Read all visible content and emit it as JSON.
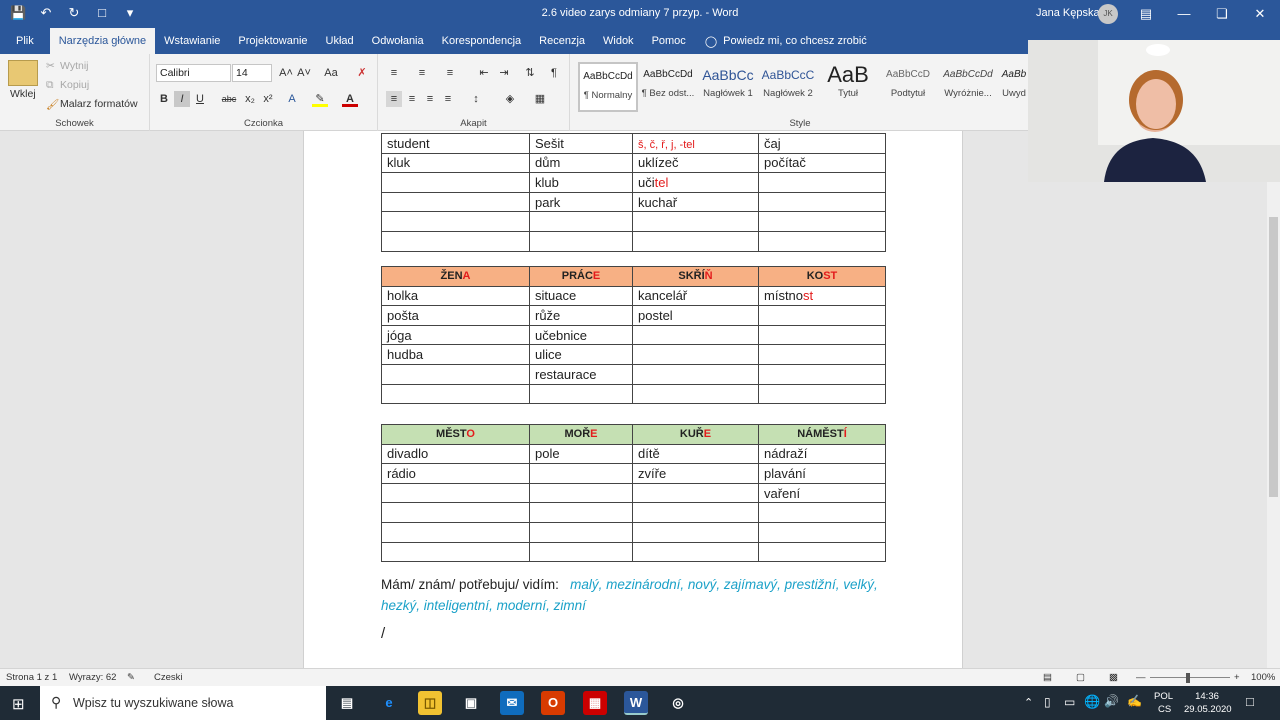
{
  "window": {
    "title": "2.6 video zarys odmiany 7 przyp.  -  Word",
    "user_name": "Jana Kępska",
    "user_initials": "JK"
  },
  "tabs": [
    "Plik",
    "Narzędzia główne",
    "Wstawianie",
    "Projektowanie",
    "Układ",
    "Odwołania",
    "Korespondencja",
    "Recenzja",
    "Widok",
    "Pomoc"
  ],
  "active_tab": "Narzędzia główne",
  "tell_me": "Powiedz mi, co chcesz zrobić",
  "ribbon": {
    "clipboard": {
      "paste": "Wklej",
      "cut": "Wytnij",
      "copy": "Kopiuj",
      "format_painter": "Malarz formatów",
      "label": "Schowek"
    },
    "font": {
      "name": "Calibri",
      "size": "14",
      "label": "Czcionka"
    },
    "paragraph": {
      "label": "Akapit"
    },
    "styles": {
      "label": "Style",
      "items": [
        {
          "preview": "AaBbCcDd",
          "name": "¶ Normalny"
        },
        {
          "preview": "AaBbCcDd",
          "name": "¶ Bez odst..."
        },
        {
          "preview": "AaBbCc",
          "name": "Nagłówek 1"
        },
        {
          "preview": "AaBbCcC",
          "name": "Nagłówek 2"
        },
        {
          "preview": "AaB",
          "name": "Tytuł"
        },
        {
          "preview": "AaBbCcD",
          "name": "Podtytuł"
        },
        {
          "preview": "AaBbCcDd",
          "name": "Wyróżnie..."
        },
        {
          "preview": "AaBb",
          "name": "Uwyd"
        }
      ]
    }
  },
  "document": {
    "table1": {
      "rows": [
        [
          {
            "t": "student"
          },
          {
            "t": "Sešit"
          },
          {
            "t": "š, č, ř, j, -tel",
            "red": true,
            "small": true
          },
          {
            "t": "čaj"
          }
        ],
        [
          {
            "t": "kluk"
          },
          {
            "t": "dům"
          },
          {
            "t": "uklízeč"
          },
          {
            "t": "počítač"
          }
        ],
        [
          {
            "t": ""
          },
          {
            "t": "klub"
          },
          {
            "p": [
              "uči",
              "tel"
            ]
          },
          {
            "t": ""
          }
        ],
        [
          {
            "t": ""
          },
          {
            "t": "park"
          },
          {
            "t": "kuchař"
          },
          {
            "t": ""
          }
        ],
        [
          {
            "t": ""
          },
          {
            "t": ""
          },
          {
            "t": ""
          },
          {
            "t": ""
          }
        ],
        [
          {
            "t": ""
          },
          {
            "t": ""
          },
          {
            "t": ""
          },
          {
            "t": ""
          }
        ]
      ]
    },
    "table2": {
      "header": [
        [
          "ŽEN",
          "A"
        ],
        [
          "PRÁC",
          "E"
        ],
        [
          "SKŘÍ",
          "Ň"
        ],
        [
          "KO",
          "ST"
        ]
      ],
      "rows": [
        [
          {
            "t": "holka"
          },
          {
            "t": "situace"
          },
          {
            "t": "kancelář"
          },
          {
            "p": [
              "místno",
              "st"
            ]
          }
        ],
        [
          {
            "t": "pošta"
          },
          {
            "t": "růže"
          },
          {
            "t": "postel"
          },
          {
            "t": ""
          }
        ],
        [
          {
            "t": "jóga"
          },
          {
            "t": "učebnice"
          },
          {
            "t": ""
          },
          {
            "t": ""
          }
        ],
        [
          {
            "t": "hudba"
          },
          {
            "t": "ulice"
          },
          {
            "t": ""
          },
          {
            "t": ""
          }
        ],
        [
          {
            "t": ""
          },
          {
            "t": "restaurace"
          },
          {
            "t": ""
          },
          {
            "t": ""
          }
        ],
        [
          {
            "t": ""
          },
          {
            "t": ""
          },
          {
            "t": ""
          },
          {
            "t": ""
          }
        ]
      ]
    },
    "table3": {
      "header": [
        [
          "MĚST",
          "O"
        ],
        [
          "MOŘ",
          "E"
        ],
        [
          "KUŘ",
          "E"
        ],
        [
          "NÁMĚST",
          "Í"
        ]
      ],
      "rows": [
        [
          {
            "t": "divadlo"
          },
          {
            "t": "pole"
          },
          {
            "t": "dítě"
          },
          {
            "t": "nádraží"
          }
        ],
        [
          {
            "t": "rádio"
          },
          {
            "t": ""
          },
          {
            "t": "zvíře"
          },
          {
            "t": "plavání"
          }
        ],
        [
          {
            "t": ""
          },
          {
            "t": ""
          },
          {
            "t": ""
          },
          {
            "t": "vaření"
          }
        ],
        [
          {
            "t": ""
          },
          {
            "t": ""
          },
          {
            "t": ""
          },
          {
            "t": ""
          }
        ],
        [
          {
            "t": ""
          },
          {
            "t": ""
          },
          {
            "t": ""
          },
          {
            "t": ""
          }
        ],
        [
          {
            "t": ""
          },
          {
            "t": ""
          },
          {
            "t": ""
          },
          {
            "t": ""
          }
        ]
      ]
    },
    "sentence_lead": "Mám/ znám/ potřebuju/ vidím:",
    "sentence_adjectives": "malý, mezinárodní, nový, zajímavý, prestižní, velký, hezký, inteligentní, moderní, zimní",
    "trailing_mark": "/"
  },
  "statusbar": {
    "page": "Strona 1 z 1",
    "words": "Wyrazy: 62",
    "language": "Czeski",
    "zoom": "100%"
  },
  "taskbar": {
    "search_placeholder": "Wpisz tu wyszukiwane słowa",
    "lang1": "POL",
    "lang2": "CS",
    "time": "14:36",
    "date": "29.05.2020"
  },
  "colors": {
    "word_blue": "#2b579a",
    "header_orange": "#f7b084",
    "header_green": "#c5e0b3",
    "accent_red": "#e31c1c",
    "adjective_cyan": "#1ba1c8"
  }
}
